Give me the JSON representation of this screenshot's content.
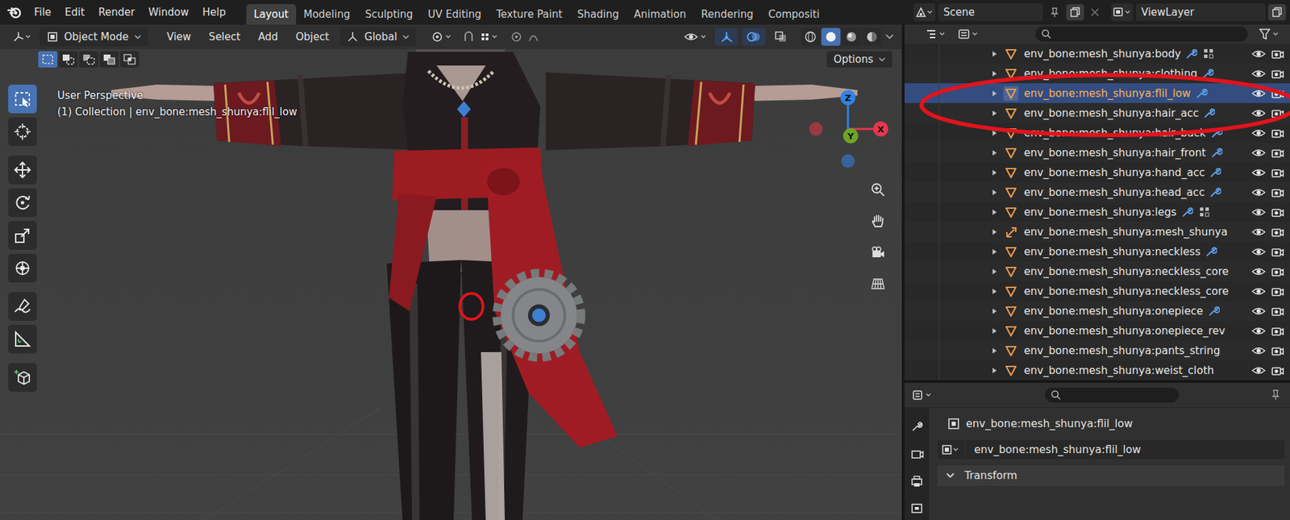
{
  "menu": [
    "File",
    "Edit",
    "Render",
    "Window",
    "Help"
  ],
  "workspaces": [
    {
      "label": "Layout",
      "selected": true
    },
    {
      "label": "Modeling",
      "selected": false
    },
    {
      "label": "Sculpting",
      "selected": false
    },
    {
      "label": "UV Editing",
      "selected": false
    },
    {
      "label": "Texture Paint",
      "selected": false
    },
    {
      "label": "Shading",
      "selected": false
    },
    {
      "label": "Animation",
      "selected": false
    },
    {
      "label": "Rendering",
      "selected": false
    },
    {
      "label": "Compositi",
      "selected": false
    }
  ],
  "scene": {
    "name": "Scene"
  },
  "view_layer": {
    "name": "ViewLayer"
  },
  "viewport": {
    "mode": "Object Mode",
    "menus": [
      "View",
      "Select",
      "Add",
      "Object"
    ],
    "orientation": "Global",
    "options": "Options",
    "view_name": "User Perspective",
    "info": "(1) Collection | env_bone:mesh_shunya:flil_low",
    "select_modes": [
      {
        "kind": "set",
        "selected": true
      },
      {
        "kind": "extend",
        "selected": false
      },
      {
        "kind": "subtract",
        "selected": false
      },
      {
        "kind": "invert",
        "selected": false
      },
      {
        "kind": "intersect",
        "selected": false
      }
    ],
    "toggles": [
      {
        "kind": "gizmo",
        "on": true
      },
      {
        "kind": "overlay",
        "on": true
      },
      {
        "kind": "xray",
        "on": false
      }
    ],
    "shading": [
      {
        "kind": "wireframe",
        "selected": false
      },
      {
        "kind": "solid",
        "selected": true
      },
      {
        "kind": "material",
        "selected": false
      },
      {
        "kind": "rendered",
        "selected": false
      }
    ],
    "gizmo": [
      {
        "label": "X",
        "color": "#e8374d"
      },
      {
        "label": "Y",
        "color": "#6ea525"
      },
      {
        "label": "Z",
        "color": "#3183e6"
      }
    ],
    "toolbar": [
      {
        "kind": "select",
        "selected": true
      },
      {
        "kind": "cursor",
        "selected": false
      },
      {
        "kind": "move",
        "selected": false
      },
      {
        "kind": "rotate",
        "selected": false
      },
      {
        "kind": "scale",
        "selected": false
      },
      {
        "kind": "transform",
        "selected": false
      },
      {
        "kind": "annotate",
        "selected": false
      },
      {
        "kind": "measure",
        "selected": false
      },
      {
        "kind": "add-cube",
        "selected": false
      }
    ]
  },
  "outliner": {
    "rows": [
      {
        "name": "env_bone:mesh_shunya:body",
        "kind": "mesh",
        "selected": false,
        "modifier": true,
        "vertex_groups": true,
        "visible": true
      },
      {
        "name": "env_bone:mesh_shunya:clothing",
        "kind": "mesh",
        "selected": false,
        "modifier": true,
        "vertex_groups": false,
        "visible": true
      },
      {
        "name": "env_bone:mesh_shunya:flil_low",
        "kind": "mesh",
        "selected": true,
        "modifier": true,
        "vertex_groups": false,
        "visible": true
      },
      {
        "name": "env_bone:mesh_shunya:hair_acc",
        "kind": "mesh",
        "selected": false,
        "modifier": true,
        "vertex_groups": false,
        "visible": true
      },
      {
        "name": "env_bone:mesh_shunya:hair_back",
        "kind": "mesh",
        "selected": false,
        "modifier": true,
        "vertex_groups": false,
        "visible": true
      },
      {
        "name": "env_bone:mesh_shunya:hair_front",
        "kind": "mesh",
        "selected": false,
        "modifier": true,
        "vertex_groups": false,
        "visible": true
      },
      {
        "name": "env_bone:mesh_shunya:hand_acc",
        "kind": "mesh",
        "selected": false,
        "modifier": true,
        "vertex_groups": false,
        "visible": true
      },
      {
        "name": "env_bone:mesh_shunya:head_acc",
        "kind": "mesh",
        "selected": false,
        "modifier": true,
        "vertex_groups": false,
        "visible": true
      },
      {
        "name": "env_bone:mesh_shunya:legs",
        "kind": "mesh",
        "selected": false,
        "modifier": true,
        "vertex_groups": true,
        "visible": true
      },
      {
        "name": "env_bone:mesh_shunya:mesh_shunya",
        "kind": "armature",
        "selected": false,
        "modifier": false,
        "vertex_groups": false,
        "visible": true
      },
      {
        "name": "env_bone:mesh_shunya:neckless",
        "kind": "mesh",
        "selected": false,
        "modifier": true,
        "vertex_groups": false,
        "visible": true
      },
      {
        "name": "env_bone:mesh_shunya:neckless_core",
        "kind": "mesh",
        "selected": false,
        "modifier": false,
        "vertex_groups": false,
        "visible": true
      },
      {
        "name": "env_bone:mesh_shunya:neckless_core",
        "kind": "mesh",
        "selected": false,
        "modifier": false,
        "vertex_groups": false,
        "visible": true
      },
      {
        "name": "env_bone:mesh_shunya:onepiece",
        "kind": "mesh",
        "selected": false,
        "modifier": true,
        "vertex_groups": false,
        "visible": true
      },
      {
        "name": "env_bone:mesh_shunya:onepiece_rev",
        "kind": "mesh",
        "selected": false,
        "modifier": false,
        "vertex_groups": false,
        "visible": true
      },
      {
        "name": "env_bone:mesh_shunya:pants_string",
        "kind": "mesh",
        "selected": false,
        "modifier": false,
        "vertex_groups": false,
        "visible": true
      },
      {
        "name": "env_bone:mesh_shunya:weist_cloth",
        "kind": "mesh",
        "selected": false,
        "modifier": false,
        "vertex_groups": false,
        "visible": true
      }
    ]
  },
  "properties": {
    "object_name": "env_bone:mesh_shunya:flil_low",
    "data_name": "env_bone:mesh_shunya:flil_low",
    "tabs": [
      {
        "kind": "tool",
        "selected": false
      },
      {
        "kind": "render",
        "selected": false
      },
      {
        "kind": "output",
        "selected": false
      },
      {
        "kind": "view-layer",
        "selected": false
      }
    ],
    "panels": [
      {
        "label": "Transform",
        "expanded": true
      }
    ]
  }
}
